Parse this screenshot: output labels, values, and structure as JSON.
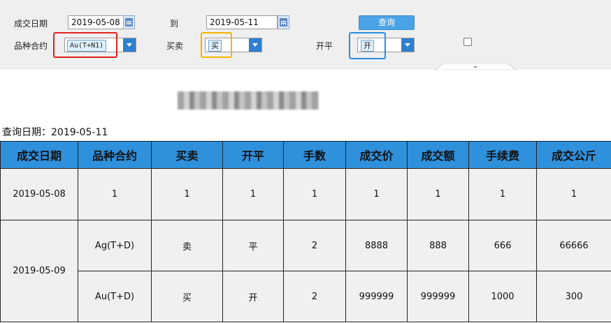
{
  "filters": {
    "trade_date_label": "成交日期",
    "date_from": "2019-05-08",
    "to_label": "到",
    "date_to": "2019-05-11",
    "query_button": "查询",
    "contract_label": "品种合约",
    "contract_value": "Au(T+N1)",
    "side_label": "买卖",
    "side_value": "买",
    "open_close_label": "开平",
    "open_close_value": "开",
    "highlight_colors": {
      "contract": "#e0211e",
      "side": "#f4b400",
      "open_close": "#2a8ee0"
    }
  },
  "query_date_text": "查询日期：2019-05-11",
  "table": {
    "headers": [
      "成交日期",
      "品种合约",
      "买卖",
      "开平",
      "手数",
      "成交价",
      "成交额",
      "手续费",
      "成交公斤"
    ],
    "rows": [
      {
        "date": "2019-05-08",
        "contract": "1",
        "side": "1",
        "open_close": "1",
        "lots": "1",
        "price": "1",
        "amount": "1",
        "fee": "1",
        "kg": "1"
      },
      {
        "date": "2019-05-09",
        "contract": "Ag(T+D)",
        "side": "卖",
        "open_close": "平",
        "lots": "2",
        "price": "8888",
        "amount": "888",
        "fee": "666",
        "kg": "66666"
      },
      {
        "contract": "Au(T+D)",
        "side": "买",
        "open_close": "开",
        "lots": "2",
        "price": "999999",
        "amount": "999999",
        "fee": "1000",
        "kg": "300"
      }
    ]
  }
}
